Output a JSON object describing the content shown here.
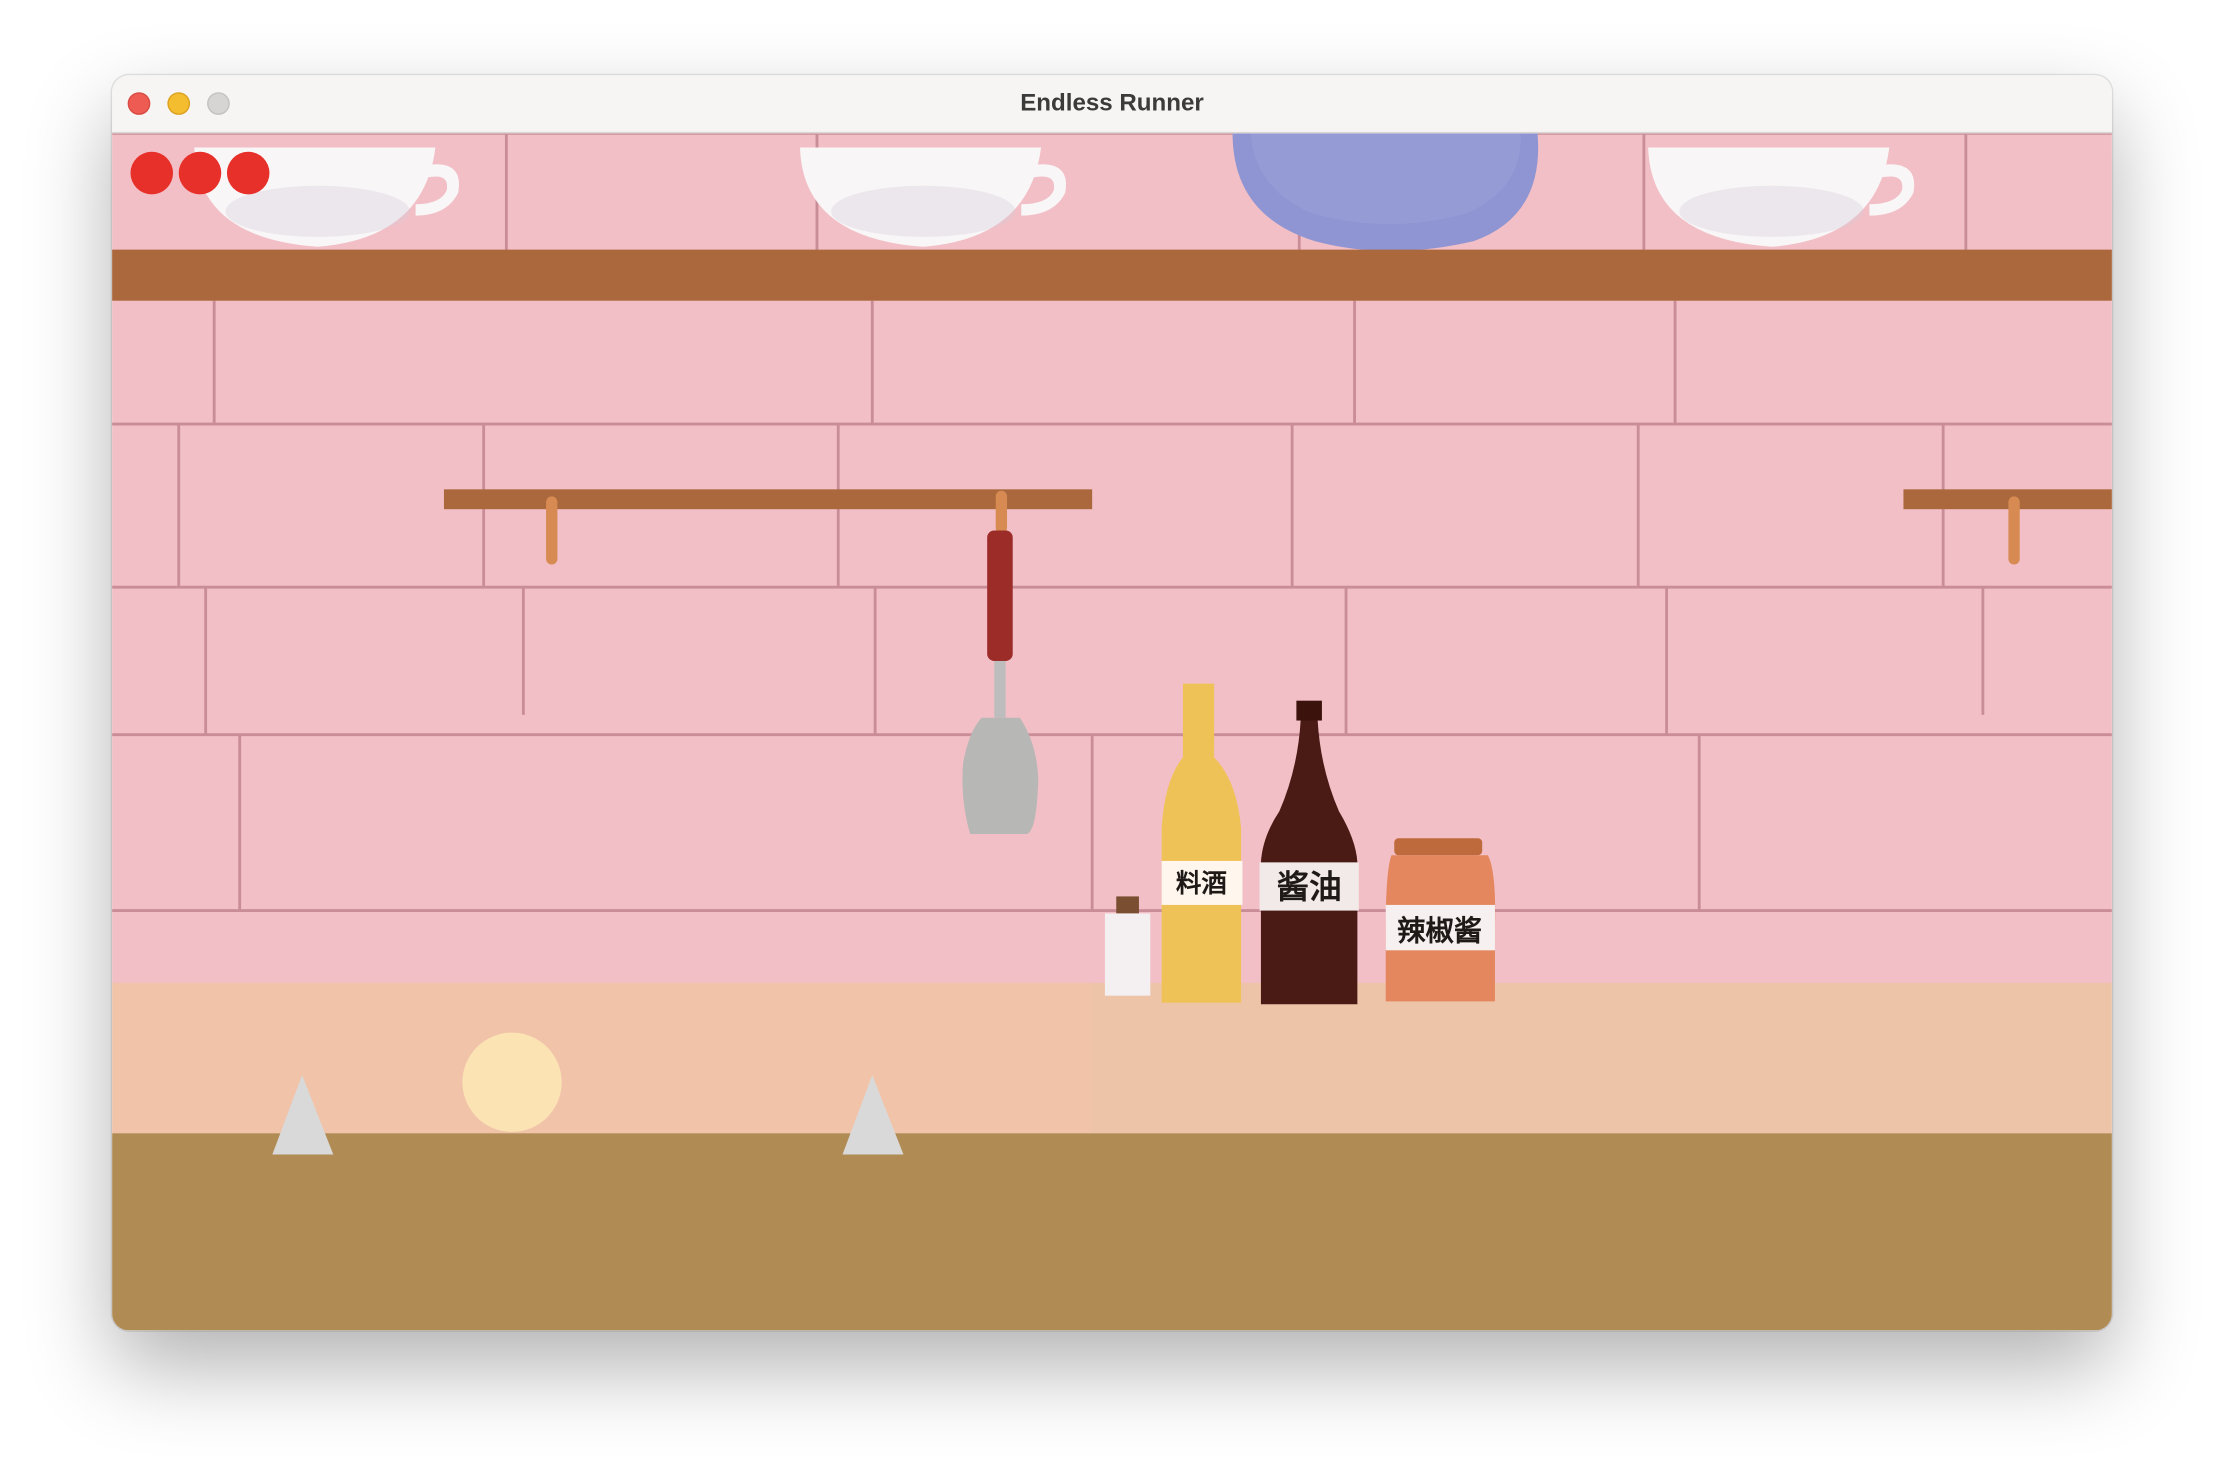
{
  "window": {
    "title": "Endless Runner"
  },
  "hud": {
    "lives": 3,
    "life_color": "#e8302a"
  },
  "player": {
    "color": "#fbe3b4"
  },
  "obstacles": {
    "type": "spike",
    "color": "#d9d9d9",
    "count": 2
  },
  "scene": {
    "wall_color": "#f2bfc6",
    "shelf_color": "#aa683c",
    "counter_color": "#eec4a9",
    "ground_color": "#b18b54",
    "bottle_labels": {
      "cooking_wine": "料酒",
      "soy_sauce": "酱油",
      "chili_sauce": "辣椒酱"
    }
  }
}
